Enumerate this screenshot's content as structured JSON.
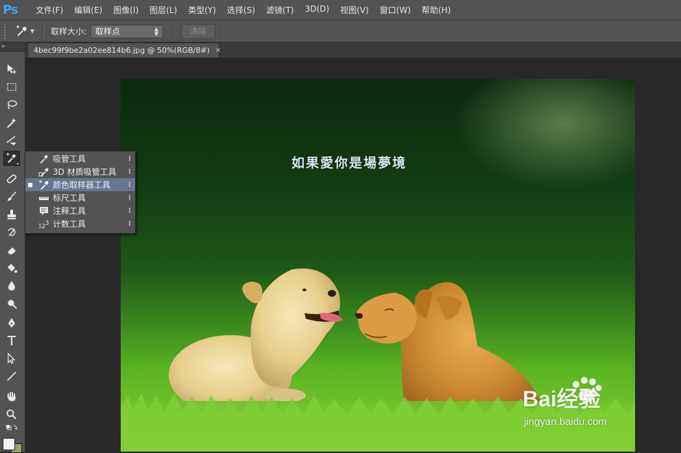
{
  "app": {
    "logo": "Ps"
  },
  "menu": [
    "文件(F)",
    "编辑(E)",
    "图像(I)",
    "图层(L)",
    "类型(Y)",
    "选择(S)",
    "滤镜(T)",
    "3D(D)",
    "视图(V)",
    "窗口(W)",
    "帮助(H)"
  ],
  "options": {
    "sample_size_label": "取样大小:",
    "sample_size_value": "取样点",
    "clear_label": "清除"
  },
  "document": {
    "tab_title": "4bec99f9be2a02ee814b6.jpg @ 50%(RGB/8#)",
    "close_glyph": "×"
  },
  "canvas": {
    "caption": "如果愛你是場夢境",
    "watermark_brand": "Bai经验",
    "watermark_url": "jingyan.baidu.com"
  },
  "flyout": [
    {
      "label": "吸管工具",
      "shortcut": "I",
      "icon": "eyedropper-icon",
      "selected": false
    },
    {
      "label": "3D 材质吸管工具",
      "shortcut": "I",
      "icon": "material-eyedropper-icon",
      "selected": false
    },
    {
      "label": "颜色取样器工具",
      "shortcut": "I",
      "icon": "color-sampler-icon",
      "selected": true
    },
    {
      "label": "标尺工具",
      "shortcut": "I",
      "icon": "ruler-icon",
      "selected": false
    },
    {
      "label": "注释工具",
      "shortcut": "I",
      "icon": "note-icon",
      "selected": false
    },
    {
      "label": "计数工具",
      "shortcut": "I",
      "icon": "count-icon",
      "selected": false
    }
  ],
  "colors": {
    "foreground": "#f2f2f2",
    "background": "#9aa06a",
    "selection_highlight": "#677593"
  }
}
